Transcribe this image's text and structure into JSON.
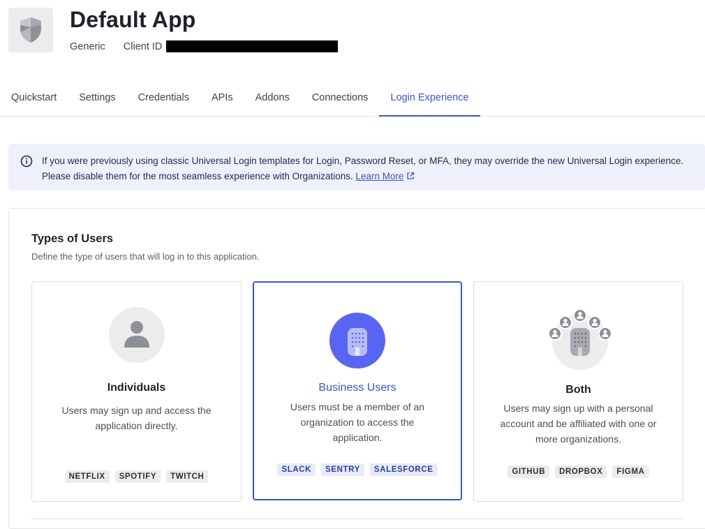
{
  "app": {
    "title": "Default App",
    "type": "Generic",
    "client_id_label": "Client ID"
  },
  "tabs": [
    {
      "label": "Quickstart",
      "active": false
    },
    {
      "label": "Settings",
      "active": false
    },
    {
      "label": "Credentials",
      "active": false
    },
    {
      "label": "APIs",
      "active": false
    },
    {
      "label": "Addons",
      "active": false
    },
    {
      "label": "Connections",
      "active": false
    },
    {
      "label": "Login Experience",
      "active": true
    }
  ],
  "banner": {
    "text": "If you were previously using classic Universal Login templates for Login, Password Reset, or MFA, they may override the new Universal Login experience. Please disable them for the most seamless experience with Organizations.",
    "link": "Learn More"
  },
  "user_types": {
    "title": "Types of Users",
    "subtitle": "Define the type of users that will log in to this application.",
    "cards": [
      {
        "title": "Individuals",
        "desc": "Users may sign up and access the application directly.",
        "tags": [
          "NETFLIX",
          "SPOTIFY",
          "TWITCH"
        ],
        "selected": false
      },
      {
        "title": "Business Users",
        "desc": "Users must be a member of an organization to access the application.",
        "tags": [
          "SLACK",
          "SENTRY",
          "SALESFORCE"
        ],
        "selected": true
      },
      {
        "title": "Both",
        "desc": "Users may sign up with a personal account and be affiliated with one or more organizations.",
        "tags": [
          "GITHUB",
          "DROPBOX",
          "FIGMA"
        ],
        "selected": false
      }
    ]
  },
  "colors": {
    "accent": "#3b55c9",
    "banner_bg": "#eef0fc",
    "business_circle": "#5865f2"
  }
}
